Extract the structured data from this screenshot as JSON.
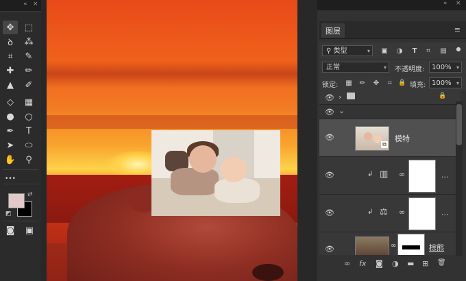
{
  "toolbar": {
    "collapse_glyph": "«",
    "close_glyph": "×",
    "more_glyph": "•••",
    "tools": [
      {
        "name": "move-tool",
        "glyph": "✥"
      },
      {
        "name": "marquee-tool",
        "glyph": "⬚"
      },
      {
        "name": "lasso-tool",
        "glyph": "ꝺ"
      },
      {
        "name": "magic-wand-tool",
        "glyph": "⁂"
      },
      {
        "name": "crop-tool",
        "glyph": "⌗"
      },
      {
        "name": "eyedropper-tool",
        "glyph": "✎"
      },
      {
        "name": "healing-brush-tool",
        "glyph": "✚"
      },
      {
        "name": "brush-tool",
        "glyph": "✏"
      },
      {
        "name": "clone-stamp-tool",
        "glyph": "▲"
      },
      {
        "name": "history-brush-tool",
        "glyph": "✐"
      },
      {
        "name": "eraser-tool",
        "glyph": "◇"
      },
      {
        "name": "gradient-tool",
        "glyph": "▦"
      },
      {
        "name": "blur-tool",
        "glyph": "●"
      },
      {
        "name": "dodge-tool",
        "glyph": "○"
      },
      {
        "name": "pen-tool",
        "glyph": "✒"
      },
      {
        "name": "type-tool",
        "glyph": "T"
      },
      {
        "name": "path-selection-tool",
        "glyph": "➤"
      },
      {
        "name": "shape-tool",
        "glyph": "⬭"
      },
      {
        "name": "hand-tool",
        "glyph": "✋"
      },
      {
        "name": "zoom-tool",
        "glyph": "⚲"
      }
    ],
    "foreground_color": "#e2c9c9",
    "background_color": "#000000",
    "swap_glyph": "⇄",
    "default_glyph": "◩",
    "quick_mask_glyph": "◙",
    "screen_mode_glyph": "▣"
  },
  "panel": {
    "collapse_glyph": "»",
    "close_glyph": "×",
    "tab_label": "图层",
    "menu_glyph": "≡",
    "filter": {
      "search_glyph": "⚲",
      "kind_label": "类型",
      "icons": [
        "▣",
        "◑",
        "T",
        "⌗",
        "▤"
      ],
      "toggle_glyph": "●"
    },
    "blend": {
      "mode": "正常",
      "opacity_label": "不透明度:",
      "opacity_value": "100%"
    },
    "lock": {
      "label": "锁定:",
      "icons": [
        "▦",
        "✏",
        "✥",
        "⌗",
        "🔒"
      ],
      "fill_label": "填充:",
      "fill_value": "100%"
    },
    "layers": [
      {
        "kind": "group",
        "name": "",
        "expand": "›",
        "folder": "📁",
        "lock": "🔒",
        "eye": "👁"
      },
      {
        "kind": "group-open",
        "name": "",
        "expand": "⌄",
        "eye": "👁"
      },
      {
        "kind": "smart",
        "name": "模特",
        "eye": "👁",
        "badge": "⧉"
      },
      {
        "kind": "adjust-levels",
        "name": "",
        "eye": "👁",
        "clip": "↲",
        "adj_glyph": "▥",
        "link": "∞",
        "more": "..."
      },
      {
        "kind": "adjust-balance",
        "name": "",
        "eye": "👁",
        "clip": "↲",
        "adj_glyph": "⚖",
        "link": "∞",
        "more": "..."
      },
      {
        "kind": "masked",
        "name": "棕熊",
        "eye": "👁",
        "link": "∞"
      }
    ],
    "bottom_icons": [
      {
        "name": "link-layers-icon",
        "glyph": "∞"
      },
      {
        "name": "layer-style-icon",
        "glyph": "fx"
      },
      {
        "name": "add-mask-icon",
        "glyph": "◙"
      },
      {
        "name": "adjustment-layer-icon",
        "glyph": "◑"
      },
      {
        "name": "new-group-icon",
        "glyph": "▬"
      },
      {
        "name": "new-layer-icon",
        "glyph": "⊞"
      },
      {
        "name": "delete-layer-icon",
        "glyph": "🗑"
      }
    ]
  }
}
